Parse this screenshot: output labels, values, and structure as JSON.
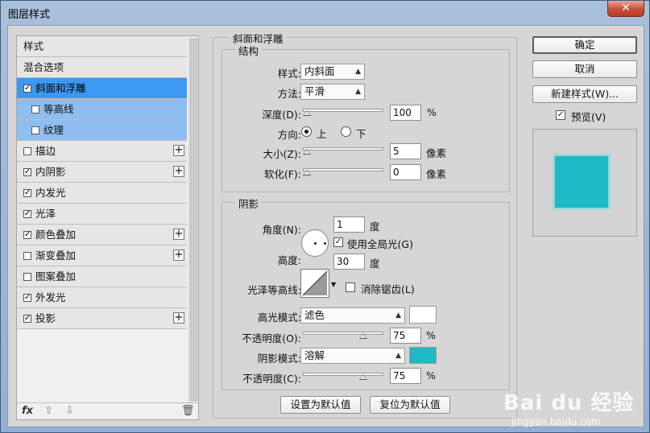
{
  "window": {
    "title": "图层样式",
    "close_label": "✕"
  },
  "left_panel": {
    "items": [
      {
        "label": "样式",
        "checkbox": false,
        "plus": false,
        "state": "normal"
      },
      {
        "label": "混合选项",
        "checkbox": false,
        "plus": false,
        "state": "normal"
      },
      {
        "label": "斜面和浮雕",
        "checkbox": true,
        "checked": true,
        "plus": false,
        "state": "selected"
      },
      {
        "label": "等高线",
        "checkbox": true,
        "checked": false,
        "plus": false,
        "state": "sub"
      },
      {
        "label": "纹理",
        "checkbox": true,
        "checked": false,
        "plus": false,
        "state": "sub"
      },
      {
        "label": "描边",
        "checkbox": true,
        "checked": false,
        "plus": true,
        "state": "normal"
      },
      {
        "label": "内阴影",
        "checkbox": true,
        "checked": true,
        "plus": true,
        "state": "normal"
      },
      {
        "label": "内发光",
        "checkbox": true,
        "checked": true,
        "plus": false,
        "state": "normal"
      },
      {
        "label": "光泽",
        "checkbox": true,
        "checked": true,
        "plus": false,
        "state": "normal"
      },
      {
        "label": "颜色叠加",
        "checkbox": true,
        "checked": true,
        "plus": true,
        "state": "normal"
      },
      {
        "label": "渐变叠加",
        "checkbox": true,
        "checked": false,
        "plus": true,
        "state": "normal"
      },
      {
        "label": "图案叠加",
        "checkbox": true,
        "checked": false,
        "plus": false,
        "state": "normal"
      },
      {
        "label": "外发光",
        "checkbox": true,
        "checked": true,
        "plus": false,
        "state": "normal"
      },
      {
        "label": "投影",
        "checkbox": true,
        "checked": true,
        "plus": true,
        "state": "normal"
      }
    ],
    "bottom_icons": {
      "fx": "fx",
      "up": "⇧",
      "down": "⇩",
      "trash": "🗑"
    }
  },
  "bevel": {
    "group_title": "斜面和浮雕",
    "structure": {
      "title": "结构",
      "style_label": "样式:",
      "style_value": "内斜面",
      "technique_label": "方法:",
      "technique_value": "平滑",
      "depth_label": "深度(D):",
      "depth_value": "100",
      "depth_unit": "%",
      "depth_slider": 0.02,
      "direction_label": "方向:",
      "direction_up": "上",
      "direction_down": "下",
      "direction_selected": "上",
      "size_label": "大小(Z):",
      "size_value": "5",
      "size_unit": "像素",
      "size_slider": 0.02,
      "soften_label": "软化(F):",
      "soften_value": "0",
      "soften_unit": "像素",
      "soften_slider": 0.0
    },
    "shading": {
      "title": "阴影",
      "angle_label": "角度(N):",
      "angle_value": "1",
      "angle_unit": "度",
      "global_light_label": "使用全局光(G)",
      "global_light_checked": true,
      "altitude_label": "高度:",
      "altitude_value": "30",
      "altitude_unit": "度",
      "gloss_contour_label": "光泽等高线:",
      "antialias_label": "消除锯齿(L)",
      "antialias_checked": false,
      "highlight_mode_label": "高光模式:",
      "highlight_mode_value": "滤色",
      "highlight_color": "#ffffff",
      "highlight_opacity_label": "不透明度(O):",
      "highlight_opacity_value": "75",
      "highlight_opacity_unit": "%",
      "highlight_opacity_slider": 0.75,
      "shadow_mode_label": "阴影模式:",
      "shadow_mode_value": "溶解",
      "shadow_color": "#1fb9c6",
      "shadow_opacity_label": "不透明度(C):",
      "shadow_opacity_value": "75",
      "shadow_opacity_unit": "%",
      "shadow_opacity_slider": 0.75
    },
    "make_default": "设置为默认值",
    "reset_default": "复位为默认值"
  },
  "right_panel": {
    "ok": "确定",
    "cancel": "取消",
    "new_style": "新建样式(W)...",
    "preview_label": "预览(V)",
    "preview_checked": true,
    "preview_color": "#1fb9c6"
  },
  "watermark": {
    "brand": "Bai du 经验",
    "url": "jingyan.baidu.com"
  }
}
